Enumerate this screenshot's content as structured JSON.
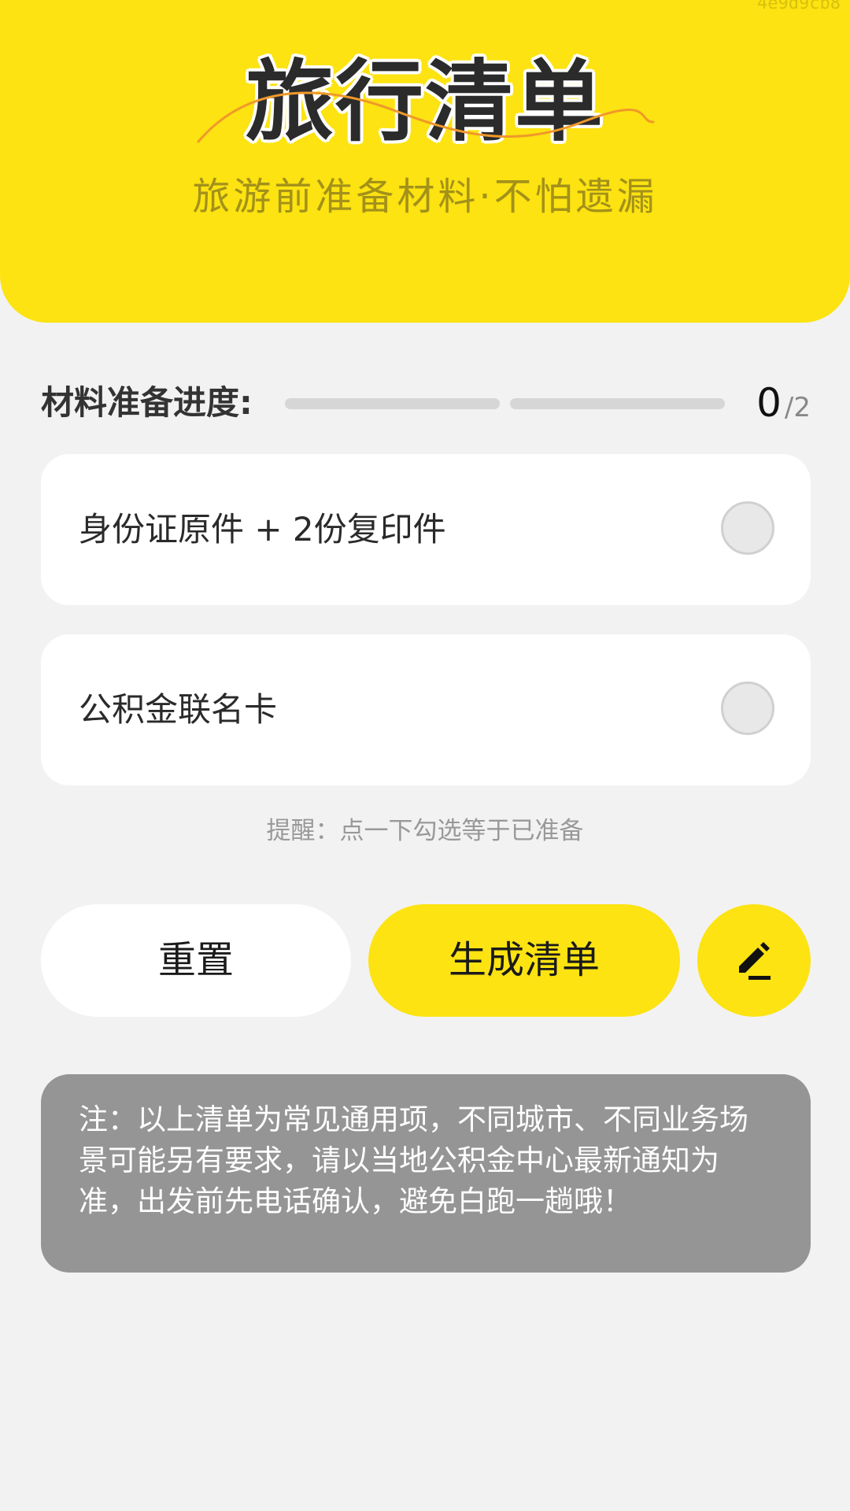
{
  "header": {
    "corner_code": "4e9d9cb8",
    "title": "旅行清单",
    "subtitle": "旅游前准备材料·不怕遗漏"
  },
  "progress": {
    "label": "材料准备进度:",
    "done": "0",
    "total": "/2",
    "completed_fraction": 0
  },
  "items": [
    {
      "label": "身份证原件 + 2份复印件",
      "checked": false
    },
    {
      "label": "公积金联名卡",
      "checked": false
    }
  ],
  "hint": "提醒：点一下勾选等于已准备",
  "buttons": {
    "reset_label": "重置",
    "generate_label": "生成清单",
    "edit_icon": "pencil-icon"
  },
  "note": "注：以上清单为常见通用项，不同城市、不同业务场景可能另有要求，请以当地公积金中心最新通知为准，出发前先电话确认，避免白跑一趟哦！",
  "colors": {
    "accent": "#fce311",
    "background": "#f2f2f2",
    "note_bg": "#959595"
  }
}
